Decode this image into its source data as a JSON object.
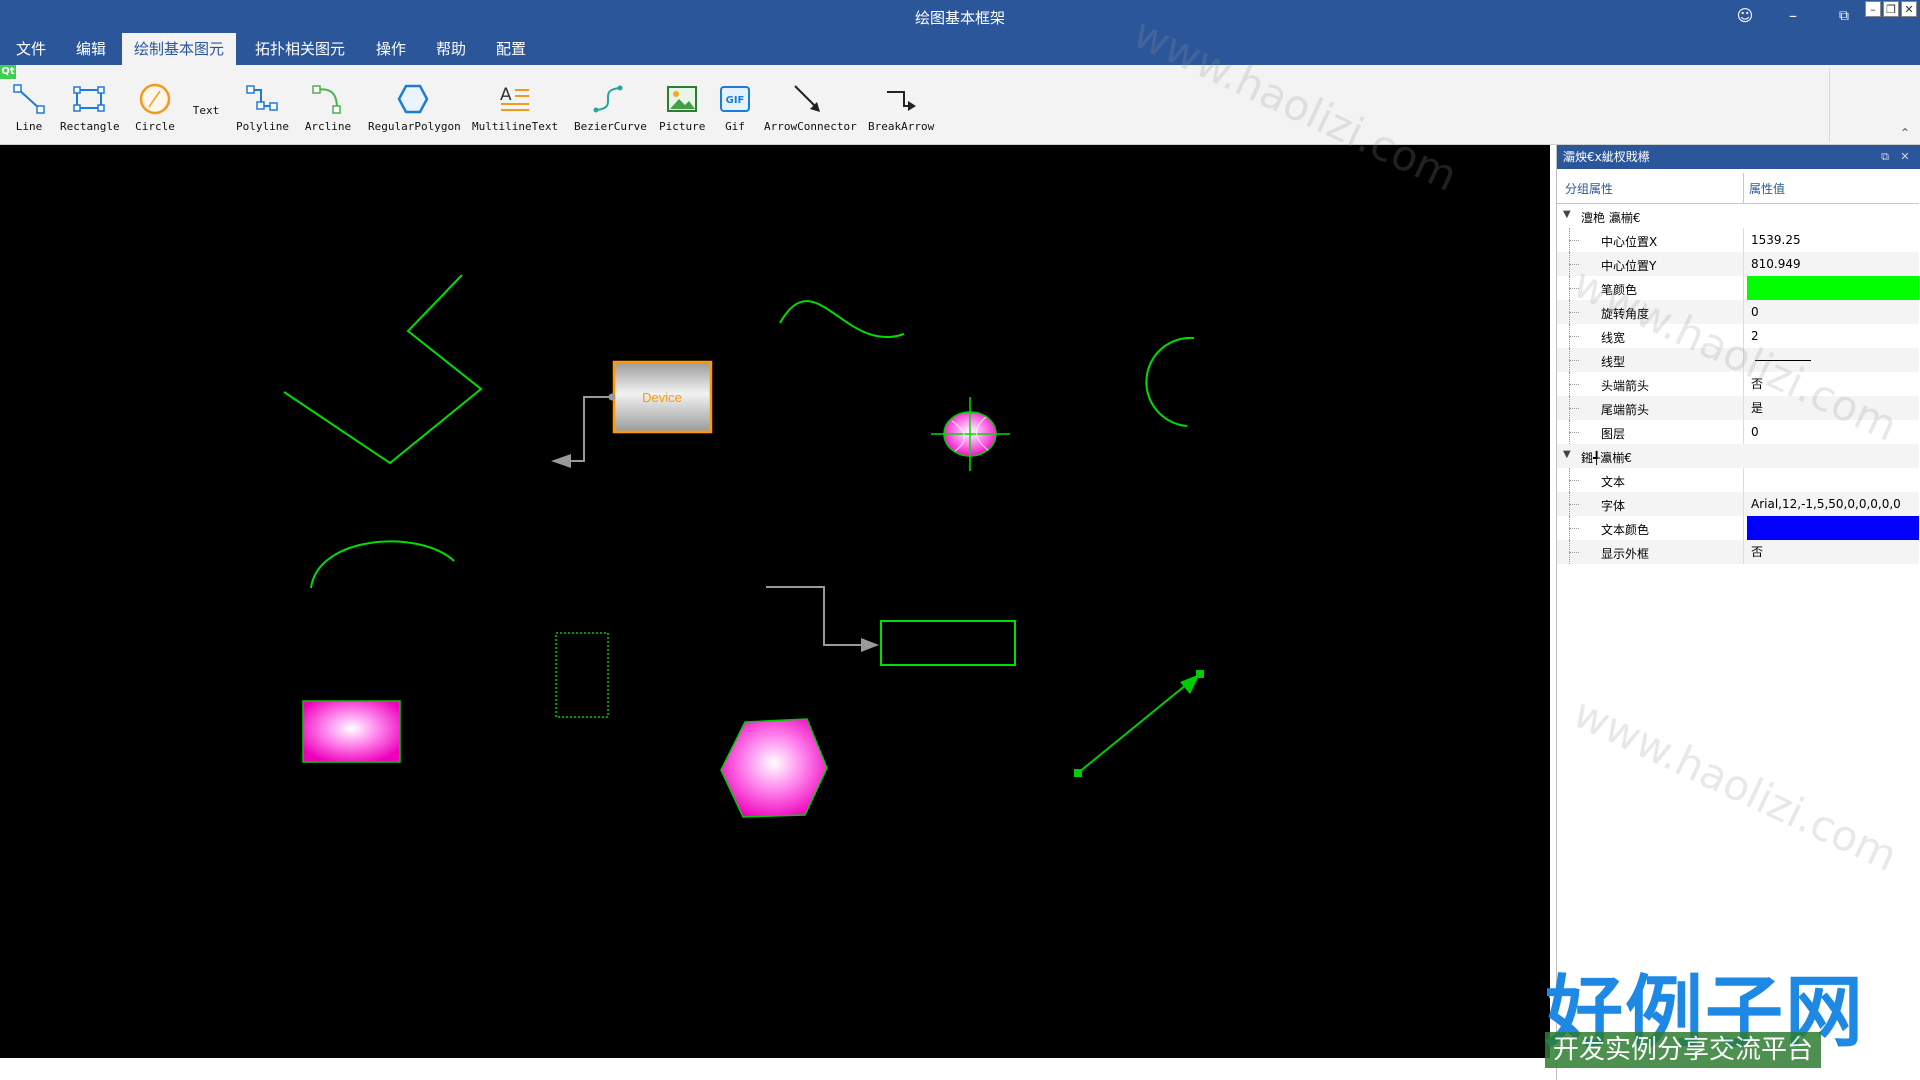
{
  "window": {
    "title": "绘图基本框架",
    "smiley_icon": "smiley-icon",
    "minimize_icon": "minimize-icon",
    "restore_icon": "restore-icon",
    "sys_min": "–",
    "sys_max": "❐",
    "sys_close": "✕"
  },
  "menu": [
    "文件",
    "编辑",
    "绘制基本图元",
    "拓扑相关图元",
    "操作",
    "帮助",
    "配置"
  ],
  "menu_active": "绘制基本图元",
  "qt_badge": "Qt",
  "toolbar": {
    "line": "Line",
    "rectangle": "Rectangle",
    "circle": "Circle",
    "text": "Text",
    "polyline": "Polyline",
    "arcline": "Arcline",
    "regular_polygon": "RegularPolygon",
    "multiline_text": "MultilineText",
    "bezier_curve": "BezierCurve",
    "picture": "Picture",
    "gif": "Gif",
    "gif_badge": "GIF",
    "arrow_connector": "ArrowConnector",
    "break_arrow": "BreakArrow",
    "collapse": "⌃"
  },
  "canvas": {
    "device_label": "Device"
  },
  "panel": {
    "title": "灞炴€х紪杈戝櫒",
    "float_btn": "⧉",
    "close_btn": "✕",
    "col_name": "分组属性",
    "col_value": "属性值",
    "groups": [
      {
        "label": "澶栬    瀛椾€",
        "rows": [
          {
            "name": "中心位置X",
            "value": "1539.25"
          },
          {
            "name": "中心位置Y",
            "value": "810.949"
          },
          {
            "name": "笔颜色",
            "value": "",
            "color": "#00ff00"
          },
          {
            "name": "旋转角度",
            "value": "0"
          },
          {
            "name": "线宽",
            "value": "2"
          },
          {
            "name": "线型",
            "value": "",
            "line": true
          },
          {
            "name": "头端箭头",
            "value": "否"
          },
          {
            "name": "尾端箭头",
            "value": "是"
          },
          {
            "name": "图层",
            "value": "0"
          }
        ]
      },
      {
        "label": "鎺╃瀛椾€",
        "rows": [
          {
            "name": "文本",
            "value": ""
          },
          {
            "name": "字体",
            "value": "Arial,12,-1,5,50,0,0,0,0,0"
          },
          {
            "name": "文本颜色",
            "value": "",
            "color": "#0000ff"
          },
          {
            "name": "显示外框",
            "value": "否"
          }
        ]
      }
    ]
  },
  "watermark": {
    "logo_main": "好例子网",
    "logo_sub": "开发实例分享交流平台",
    "tile": "www.haolizi.com"
  },
  "colors": {
    "accent": "#2b579a",
    "canvas_bg": "#000000",
    "shape_green": "#00dd00",
    "magenta": "#ff00cc",
    "orange": "#ff9900"
  }
}
